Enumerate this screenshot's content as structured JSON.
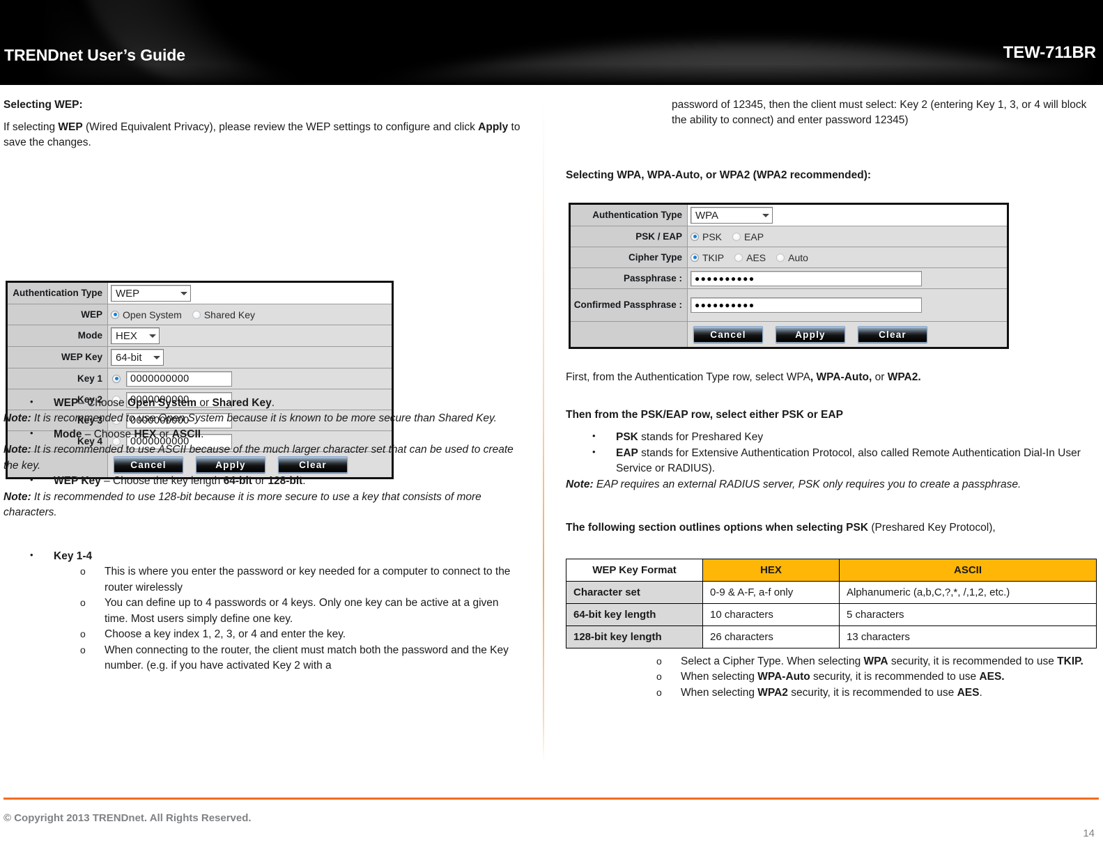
{
  "header": {
    "guide_title": "TRENDnet User’s Guide",
    "model": "TEW-711BR"
  },
  "left_column": {
    "heading": "Selecting WEP:",
    "intro_p1": "If selecting ",
    "intro_b1": "WEP",
    "intro_p2": " (Wired Equivalent Privacy), please review the WEP settings to configure and click ",
    "intro_b2": "Apply",
    "intro_p3": " to save the changes.",
    "wep_panel": {
      "rows": {
        "auth_type_label": "Authentication Type",
        "auth_type_value": "WEP",
        "wep_label": "WEP",
        "wep_opt1": "Open System",
        "wep_opt2": "Shared Key",
        "mode_label": "Mode",
        "mode_value": "HEX",
        "wep_key_label": "WEP Key",
        "wep_key_value": "64-bit",
        "key1_label": "Key 1",
        "key1_value": "0000000000",
        "key2_label": "Key 2",
        "key2_value": "0000000000",
        "key3_label": "Key 3",
        "key3_value": "0000000000",
        "key4_label": "Key 4",
        "key4_value": "0000000000"
      },
      "buttons": {
        "cancel": "Cancel",
        "apply": "Apply",
        "clear": "Clear"
      }
    },
    "bullets": [
      {
        "bold": "WEP",
        "rest_a": "– Choose ",
        "b1": "Open System",
        "mid": " or ",
        "b2": "Shared Key",
        "rest_b": "."
      },
      {
        "bold": "Mode",
        "rest_a": " – Choose ",
        "b1": "HEX",
        "mid": " or ",
        "b2": "ASCII",
        "rest_b": "."
      },
      {
        "bold": "WEP Key",
        "rest_a": " – Choose the key length ",
        "b1": "64-bit",
        "mid": " or ",
        "b2": "128-bit",
        "rest_b": "."
      }
    ],
    "notes": [
      "It is recommended to use Open System because it is known to be more secure than Shared Key.",
      "It is recommended to use ASCII because of the much larger character set that can be used to create the key.",
      "It is recommended to use 128-bit because it is more secure to use a key that consists of more characters."
    ],
    "note_label": "Note:",
    "key_bullet_title": "Key 1-4",
    "key_subitems": [
      "This is where you enter the password or key needed for a computer to connect to the router wirelessly",
      "You can define up to 4 passwords or 4 keys. Only one key can be active at a given time. Most users simply define one key.",
      "Choose a key index 1, 2, 3, or 4 and enter the key.",
      "When connecting to the router, the client must match both the password and the Key number. (e.g. if you have activated Key 2 with a"
    ]
  },
  "right_column": {
    "continued_text": "password of 12345, then the client must select: Key 2 (entering Key 1, 3, or 4 will block the ability to connect) and enter password 12345)",
    "wpa_heading": "Selecting WPA, WPA-Auto, or WPA2 (WPA2 recommended):",
    "wpa_panel": {
      "rows": {
        "auth_type_label": "Authentication Type",
        "auth_type_value": "WPA",
        "pskeap_label": "PSK / EAP",
        "pskeap_opt1": "PSK",
        "pskeap_opt2": "EAP",
        "cipher_label": "Cipher Type",
        "cipher_opt1": "TKIP",
        "cipher_opt2": "AES",
        "cipher_opt3": "Auto",
        "passphrase_label": "Passphrase :",
        "passphrase_value": "●●●●●●●●●●",
        "confirmed_label": "Confirmed Passphrase :",
        "confirmed_value": "●●●●●●●●●●"
      },
      "buttons": {
        "cancel": "Cancel",
        "apply": "Apply",
        "clear": "Clear"
      }
    },
    "first_line_a": "First, from the Authentication Type row, select WPA",
    "first_line_b": ", WPA-Auto,",
    "first_line_c": " or ",
    "first_line_d": "WPA2.",
    "then_heading": "Then from the PSK/EAP row, select either PSK or EAP",
    "psk_bullet_bold": "PSK",
    "psk_bullet_rest": " stands for Preshared Key",
    "eap_bullet_bold": "EAP",
    "eap_bullet_rest": " stands for Extensive Authentication Protocol, also called Remote Authentication Dial-In User Service or RADIUS).",
    "note_label": "Note:",
    "eap_note": "EAP requires an external RADIUS server, PSK only requires you to create a passphrase.",
    "outline_bold": "The following section outlines options when selecting PSK",
    "outline_rest": " (Preshared Key Protocol),",
    "cipher_bullets": [
      {
        "a": "Select a Cipher Type. When selecting ",
        "b1": "WPA",
        "c": " security, it is recommended to use ",
        "b2": "TKIP.",
        "d": ""
      },
      {
        "a": "When selecting ",
        "b1": "WPA-Auto",
        "c": " security, it is recommended to use ",
        "b2": "AES.",
        "d": ""
      },
      {
        "a": "When selecting ",
        "b1": "WPA2",
        "c": " security, it is recommended to use ",
        "b2": "AES",
        "d": "."
      }
    ]
  },
  "key_table": {
    "headers": [
      "WEP Key Format",
      "HEX",
      "ASCII"
    ],
    "rows": [
      [
        "Character set",
        "0-9 & A-F, a-f only",
        "Alphanumeric (a,b,C,?,*, /,1,2, etc.)"
      ],
      [
        "64-bit key length",
        "10 characters",
        "5 characters"
      ],
      [
        "128-bit key length",
        "26 characters",
        "13 characters"
      ]
    ],
    "accent_color": "#FFB606"
  },
  "footer": {
    "copyright": "© Copyright 2013 TRENDnet. All Rights Reserved.",
    "page_number": "14",
    "rule_color": "#F26C21"
  }
}
